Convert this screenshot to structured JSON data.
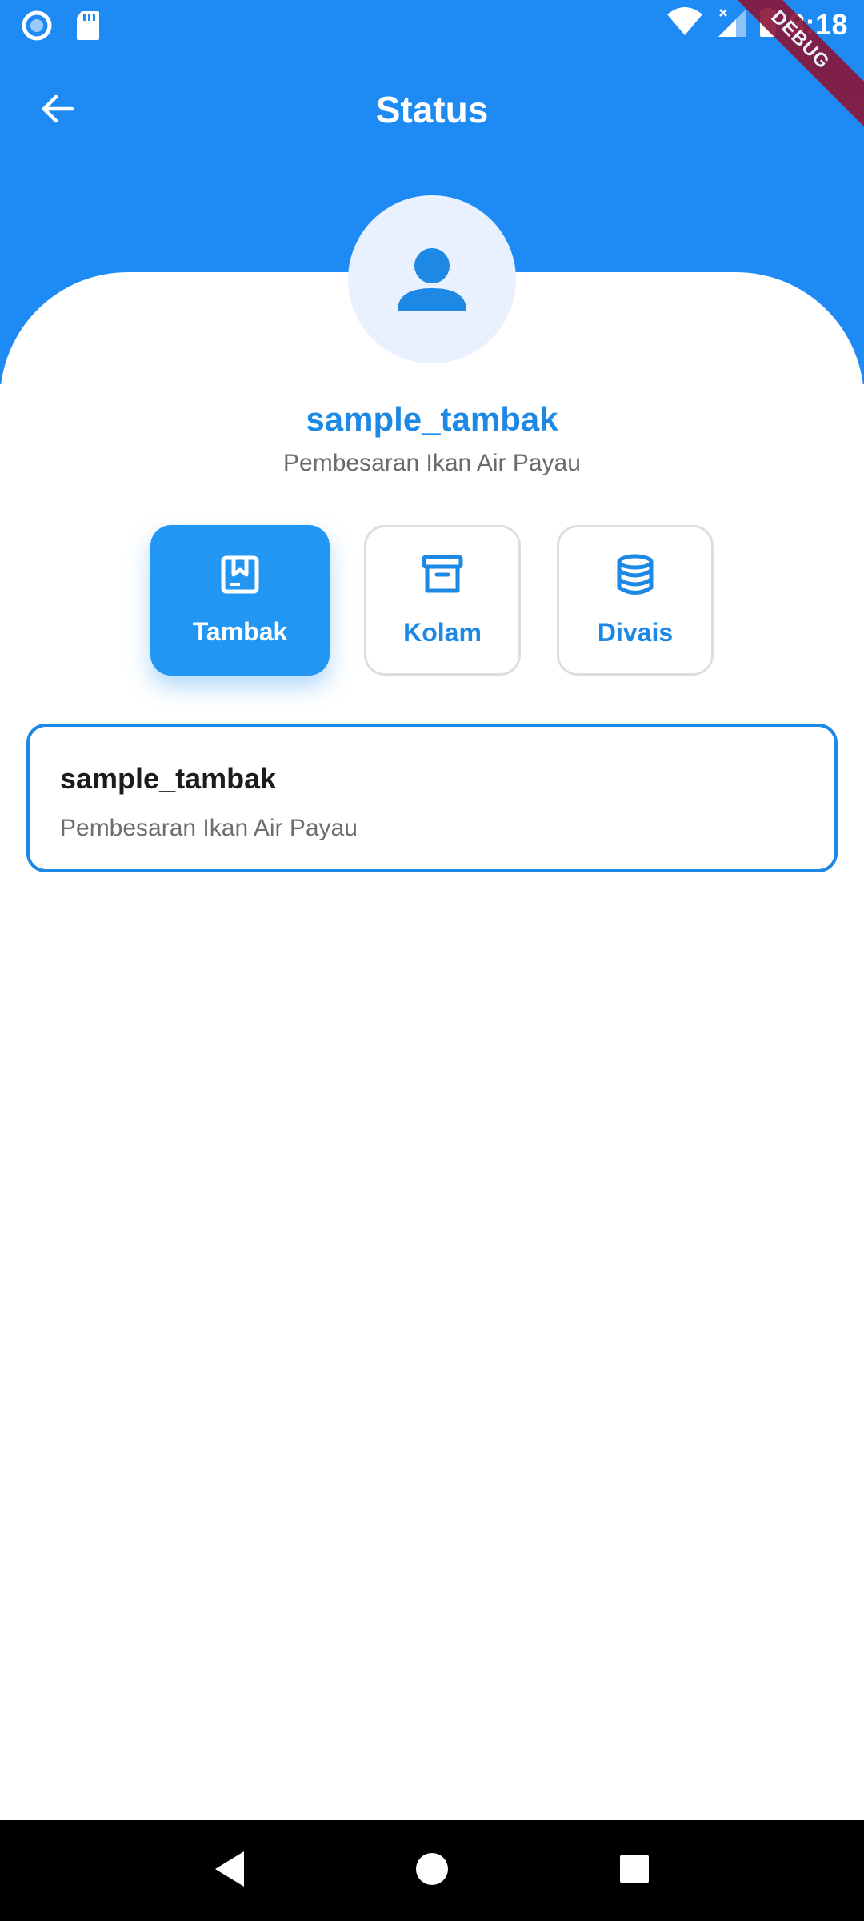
{
  "status_bar": {
    "time": "8:18",
    "icons": [
      "record-icon",
      "sd-card-icon",
      "wifi-icon",
      "signal-icon",
      "battery-icon"
    ]
  },
  "debug_label": "DEBUG",
  "app_bar": {
    "title": "Status",
    "back_icon": "arrow-back-icon"
  },
  "profile": {
    "avatar_icon": "person-icon",
    "name": "sample_tambak",
    "subtitle": "Pembesaran Ikan Air Payau"
  },
  "tabs": [
    {
      "label": "Tambak",
      "icon": "bookmark-book-icon",
      "active": true
    },
    {
      "label": "Kolam",
      "icon": "archive-box-icon",
      "active": false
    },
    {
      "label": "Divais",
      "icon": "database-icon",
      "active": false
    }
  ],
  "card": {
    "title": "sample_tambak",
    "subtitle": "Pembesaran Ikan Air Payau"
  },
  "colors": {
    "primary": "#1e8bf5",
    "accent_text": "#1e88e5",
    "active_tab": "#2196f3",
    "avatar_bg": "#e8f1fd",
    "debug_ribbon": "#8a1538"
  },
  "nav_bar": {
    "buttons": [
      "back-triangle-icon",
      "home-circle-icon",
      "recents-square-icon"
    ]
  }
}
